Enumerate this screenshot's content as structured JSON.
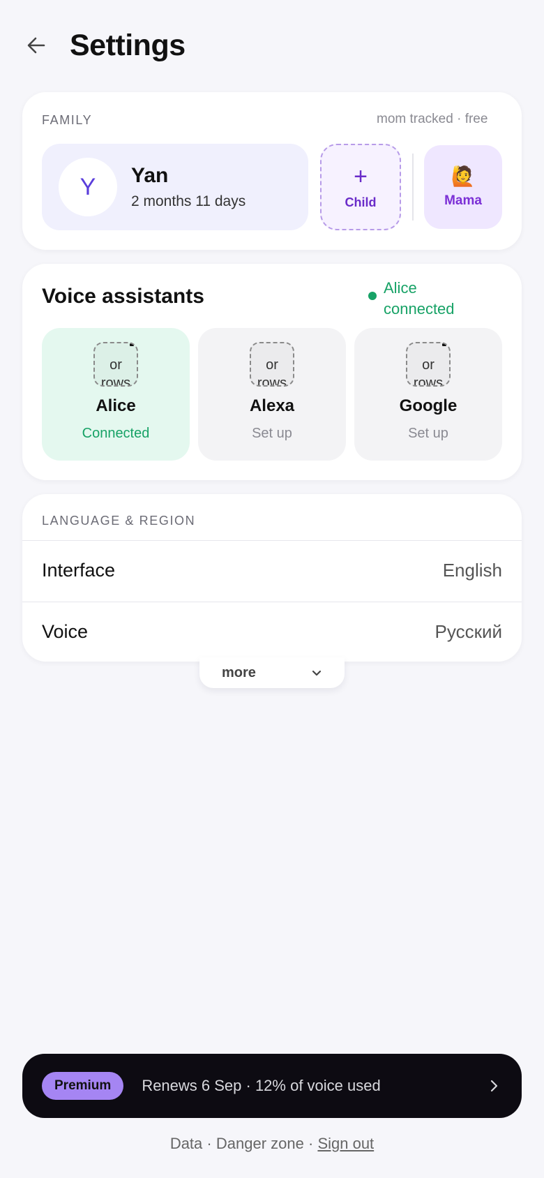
{
  "header": {
    "title": "Settings",
    "back_icon": "arrow-left-icon"
  },
  "family": {
    "section_label": "FAMILY",
    "note": "mom tracked · free",
    "child": {
      "initial": "Y",
      "name": "Yan",
      "age": "2 months 11 days"
    },
    "add_child": {
      "icon": "+",
      "label": "Child"
    },
    "parent": {
      "emoji": "🙋",
      "label": "Mama"
    }
  },
  "voice": {
    "title": "Voice assistants",
    "status": "Alice connected",
    "assistants": [
      {
        "logo_text_1": "or",
        "logo_text_2": "rows",
        "name": "Alice",
        "state": "Connected"
      },
      {
        "logo_text_1": "or",
        "logo_text_2": "rows",
        "name": "Alexa",
        "state": "Set up"
      },
      {
        "logo_text_1": "or",
        "logo_text_2": "rows",
        "name": "Google",
        "state": "Set up"
      }
    ]
  },
  "language": {
    "section_label": "LANGUAGE & REGION",
    "rows": [
      {
        "label": "Interface",
        "value": "English"
      },
      {
        "label": "Voice",
        "value": "Русский"
      }
    ],
    "more_label": "more"
  },
  "premium": {
    "badge": "Premium",
    "text": "Renews 6 Sep · 12% of voice used"
  },
  "footer": {
    "data": "Data",
    "sep": "·",
    "danger": "Danger zone",
    "signout": "Sign out"
  },
  "colors": {
    "accent_purple": "#6a2cc9",
    "connected_green": "#17a266",
    "premium_badge": "#a585f3",
    "premium_bg": "#0d0b12"
  }
}
